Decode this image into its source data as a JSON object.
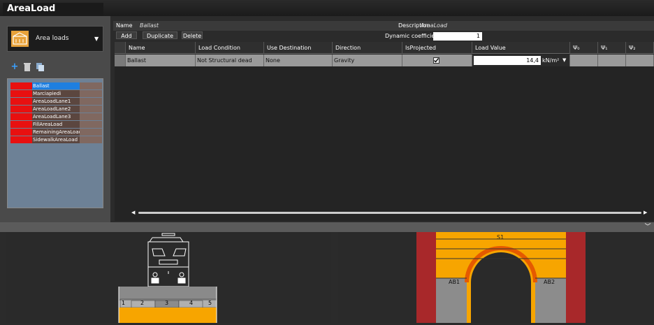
{
  "window": {
    "title": "AreaLoad"
  },
  "left_panel": {
    "dropdown_label": "Area loads",
    "list_items": [
      {
        "label": "Ballast",
        "selected": true,
        "color": "#e81010"
      },
      {
        "label": "Marciapiedi",
        "selected": false,
        "color": "#e81010"
      },
      {
        "label": "AreaLoadLane1",
        "selected": false,
        "color": "#e81010"
      },
      {
        "label": "AreaLoadLane2",
        "selected": false,
        "color": "#e81010"
      },
      {
        "label": "AreaLoadLane3",
        "selected": false,
        "color": "#e81010"
      },
      {
        "label": "FillAreaLoad",
        "selected": false,
        "color": "#e81010"
      },
      {
        "label": "RemainingAreaLoad",
        "selected": false,
        "color": "#e81010"
      },
      {
        "label": "SidewalkAreaLoad",
        "selected": false,
        "color": "#e81010"
      }
    ]
  },
  "header": {
    "name_label": "Name",
    "name_value": "Ballast",
    "description_label": "Description",
    "description_value": "AreaLoad",
    "dynamic_label": "Dynamic coefficient",
    "dynamic_value": "1"
  },
  "toolbar": {
    "add": "Add",
    "duplicate": "Duplicate",
    "delete": "Delete"
  },
  "grid": {
    "columns": [
      "Name",
      "Load Condition",
      "Use Destination",
      "Direction",
      "IsProjected",
      "Load Value",
      "Ψ₀",
      "Ψ₁",
      "Ψ₂"
    ],
    "row": {
      "name": "Ballast",
      "load_condition": "Not Structural dead",
      "use_destination": "None",
      "direction": "Gravity",
      "is_projected": true,
      "load_value": "14,4",
      "unit": "kN/m²"
    }
  },
  "diagram_left": {
    "lanes": [
      "1",
      "2",
      "3",
      "4",
      "5"
    ]
  },
  "diagram_right": {
    "labels": [
      "S1",
      "AB1",
      "AB2"
    ]
  },
  "colors": {
    "accent": "#1e7fe0",
    "orange": "#f7a500",
    "wall": "#a8282a"
  }
}
